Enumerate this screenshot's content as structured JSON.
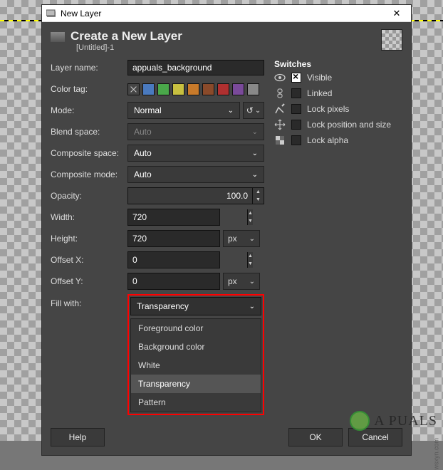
{
  "window": {
    "title": "New Layer"
  },
  "header": {
    "title": "Create a New Layer",
    "subtitle": "[Untitled]-1"
  },
  "labels": {
    "layer_name": "Layer name:",
    "color_tag": "Color tag:",
    "mode": "Mode:",
    "blend_space": "Blend space:",
    "composite_space": "Composite space:",
    "composite_mode": "Composite mode:",
    "opacity": "Opacity:",
    "width": "Width:",
    "height": "Height:",
    "offset_x": "Offset X:",
    "offset_y": "Offset Y:",
    "fill_with": "Fill with:"
  },
  "values": {
    "layer_name": "appuals_background",
    "mode": "Normal",
    "blend_space": "Auto",
    "composite_space": "Auto",
    "composite_mode": "Auto",
    "opacity": "100.0",
    "width": "720",
    "height": "720",
    "offset_x": "0",
    "offset_y": "0",
    "unit": "px",
    "fill_with": "Transparency"
  },
  "color_tags": [
    "none",
    "#4a7abf",
    "#4aa84a",
    "#c8c040",
    "#c87a2a",
    "#8a4a2a",
    "#b03030",
    "#7a4a9a",
    "#888888"
  ],
  "switches": {
    "title": "Switches",
    "items": [
      {
        "id": "visible",
        "label": "Visible",
        "checked": true
      },
      {
        "id": "linked",
        "label": "Linked",
        "checked": false
      },
      {
        "id": "lock_pixels",
        "label": "Lock pixels",
        "checked": false
      },
      {
        "id": "lock_position",
        "label": "Lock position and size",
        "checked": false
      },
      {
        "id": "lock_alpha",
        "label": "Lock alpha",
        "checked": false
      }
    ]
  },
  "fill_options": [
    "Foreground color",
    "Background color",
    "White",
    "Transparency",
    "Pattern"
  ],
  "buttons": {
    "help": "Help",
    "ok": "OK",
    "cancel": "Cancel"
  },
  "watermark": {
    "text": "A   PUALS",
    "side": "wsxyn.com"
  }
}
